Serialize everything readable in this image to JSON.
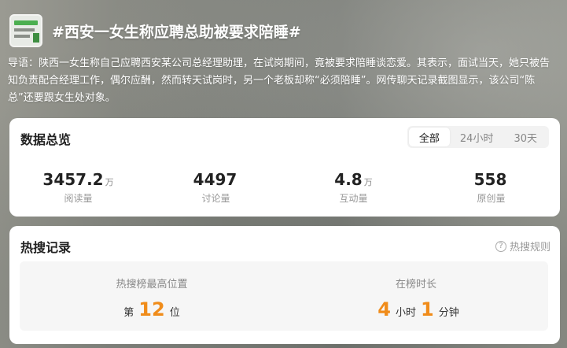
{
  "topic": {
    "title": "#西安一女生称应聘总助被要求陪睡#",
    "intro": "导语：陕西一女生称自己应聘西安某公司总经理助理，在试岗期间，竟被要求陪睡谈恋爱。其表示，面试当天，她只被告知负责配合经理工作，偶尔应酬，然而转天试岗时，另一个老板却称“必须陪睡”。网传聊天记录截图显示，该公司“陈总”还要跟女生处对象。"
  },
  "overview": {
    "title": "数据总览",
    "tabs": [
      {
        "label": "全部"
      },
      {
        "label": "24小时"
      },
      {
        "label": "30天"
      }
    ],
    "stats": [
      {
        "value": "3457.2",
        "unit": "万",
        "label": "阅读量"
      },
      {
        "value": "4497",
        "unit": "",
        "label": "讨论量"
      },
      {
        "value": "4.8",
        "unit": "万",
        "label": "互动量"
      },
      {
        "value": "558",
        "unit": "",
        "label": "原创量"
      }
    ]
  },
  "hot": {
    "title": "热搜记录",
    "rule_link": "热搜规则",
    "rule_icon": "?",
    "peak": {
      "label": "热搜榜最高位置",
      "prefix": "第",
      "number": "12",
      "suffix": "位"
    },
    "duration": {
      "label": "在榜时长",
      "hours": "4",
      "hours_unit": "小时",
      "minutes": "1",
      "minutes_unit": "分钟"
    }
  },
  "colors": {
    "accent_number": "#f08c1a"
  }
}
